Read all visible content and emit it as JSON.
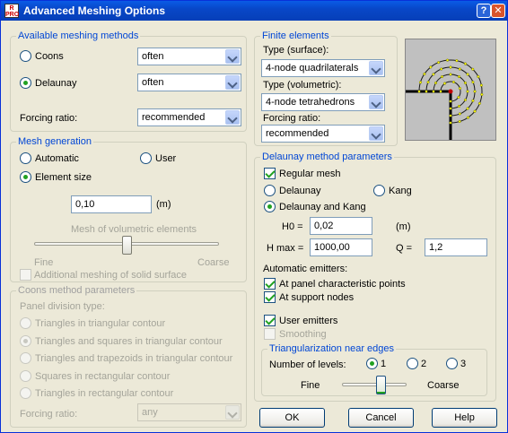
{
  "window": {
    "title": "Advanced Meshing Options",
    "help_glyph": "?",
    "close_glyph": "✕",
    "app_icon_text": "R PRO"
  },
  "meshing_methods": {
    "legend": "Available meshing methods",
    "coons_label": "Coons",
    "coons_value": "often",
    "delaunay_label": "Delaunay",
    "delaunay_value": "often",
    "forcing_label": "Forcing ratio:",
    "forcing_value": "recommended",
    "selected": "Delaunay"
  },
  "finite_elements": {
    "legend": "Finite elements",
    "surface_label": "Type (surface):",
    "surface_value": "4-node quadrilaterals",
    "volumetric_label": "Type (volumetric):",
    "volumetric_value": "4-node tetrahedrons",
    "forcing_label": "Forcing ratio:",
    "forcing_value": "recommended"
  },
  "mesh_generation": {
    "legend": "Mesh generation",
    "automatic_label": "Automatic",
    "user_label": "User",
    "element_size_label": "Element size",
    "selected": "Element size",
    "size_value": "0,10",
    "size_unit": "(m)",
    "volumetric_title": "Mesh of volumetric elements",
    "fine_label": "Fine",
    "coarse_label": "Coarse",
    "volumetric_level": 0.5,
    "solid_label": "Additional meshing of solid surface",
    "solid_checked": false
  },
  "coons_params": {
    "legend": "Coons method parameters",
    "division_label": "Panel division type:",
    "options": [
      "Triangles in triangular contour",
      "Triangles and squares in triangular contour",
      "Triangles and trapezoids in triangular contour",
      "Squares in rectangular contour",
      "Triangles in rectangular contour"
    ],
    "selected_index": 1,
    "forcing_label": "Forcing ratio:",
    "forcing_value": "any"
  },
  "delaunay_params": {
    "legend": "Delaunay method parameters",
    "regular_label": "Regular mesh",
    "regular_checked": true,
    "delaunay_label": "Delaunay",
    "kang_label": "Kang",
    "both_label": "Delaunay and Kang",
    "selected": "Delaunay and Kang",
    "h0_label": "H0 =",
    "h0_value": "0,02",
    "h0_unit": "(m)",
    "hmax_label": "H max =",
    "hmax_value": "1000,00",
    "q_label": "Q =",
    "q_value": "1,2",
    "emitters_label": "Automatic emitters:",
    "panel_points_label": "At panel characteristic points",
    "panel_points_checked": true,
    "support_nodes_label": "At support nodes",
    "support_nodes_checked": true,
    "user_emitters_label": "User emitters",
    "user_emitters_checked": true,
    "smoothing_label": "Smoothing",
    "smoothing_checked": false
  },
  "triangularization": {
    "legend": "Triangularization near edges",
    "levels_label": "Number of levels:",
    "level_options": [
      "1",
      "2",
      "3"
    ],
    "selected_level": "1",
    "fine_label": "Fine",
    "coarse_label": "Coarse",
    "level": 0.6
  },
  "buttons": {
    "ok": "OK",
    "cancel": "Cancel",
    "help": "Help"
  },
  "colors": {
    "title_bar": "#0a5ce6",
    "legend": "#0046d5",
    "radio_dot": "#21a121",
    "preview_bg": "#c0c0c0",
    "preview_node": "#ffff00"
  }
}
